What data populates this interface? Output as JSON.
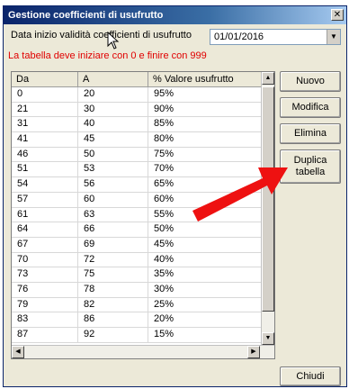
{
  "window": {
    "title": "Gestione coefficienti di usufrutto",
    "close_glyph": "✕"
  },
  "date": {
    "label": "Data inizio validità coefficienti di usufrutto",
    "value": "01/01/2016"
  },
  "warning": "La tabella deve iniziare con 0 e finire con 999",
  "table": {
    "columns": [
      "Da",
      "A",
      "% Valore usufrutto"
    ],
    "rows": [
      [
        "0",
        "20",
        "95%"
      ],
      [
        "21",
        "30",
        "90%"
      ],
      [
        "31",
        "40",
        "85%"
      ],
      [
        "41",
        "45",
        "80%"
      ],
      [
        "46",
        "50",
        "75%"
      ],
      [
        "51",
        "53",
        "70%"
      ],
      [
        "54",
        "56",
        "65%"
      ],
      [
        "57",
        "60",
        "60%"
      ],
      [
        "61",
        "63",
        "55%"
      ],
      [
        "64",
        "66",
        "50%"
      ],
      [
        "67",
        "69",
        "45%"
      ],
      [
        "70",
        "72",
        "40%"
      ],
      [
        "73",
        "75",
        "35%"
      ],
      [
        "76",
        "78",
        "30%"
      ],
      [
        "79",
        "82",
        "25%"
      ],
      [
        "83",
        "86",
        "20%"
      ],
      [
        "87",
        "92",
        "15%"
      ]
    ]
  },
  "buttons": {
    "nuovo": "Nuovo",
    "modifica": "Modifica",
    "elimina": "Elimina",
    "duplica_line1": "Duplica",
    "duplica_line2": "tabella",
    "chiudi": "Chiudi"
  },
  "colors": {
    "title_bar": "#0a246a",
    "warning_text": "#e00000",
    "annotation_arrow": "#ee1111"
  },
  "icons": {
    "close": "close-icon",
    "dropdown": "chevron-down-icon",
    "annotation": "red-arrow-annotation",
    "pointer": "mouse-cursor-icon"
  }
}
